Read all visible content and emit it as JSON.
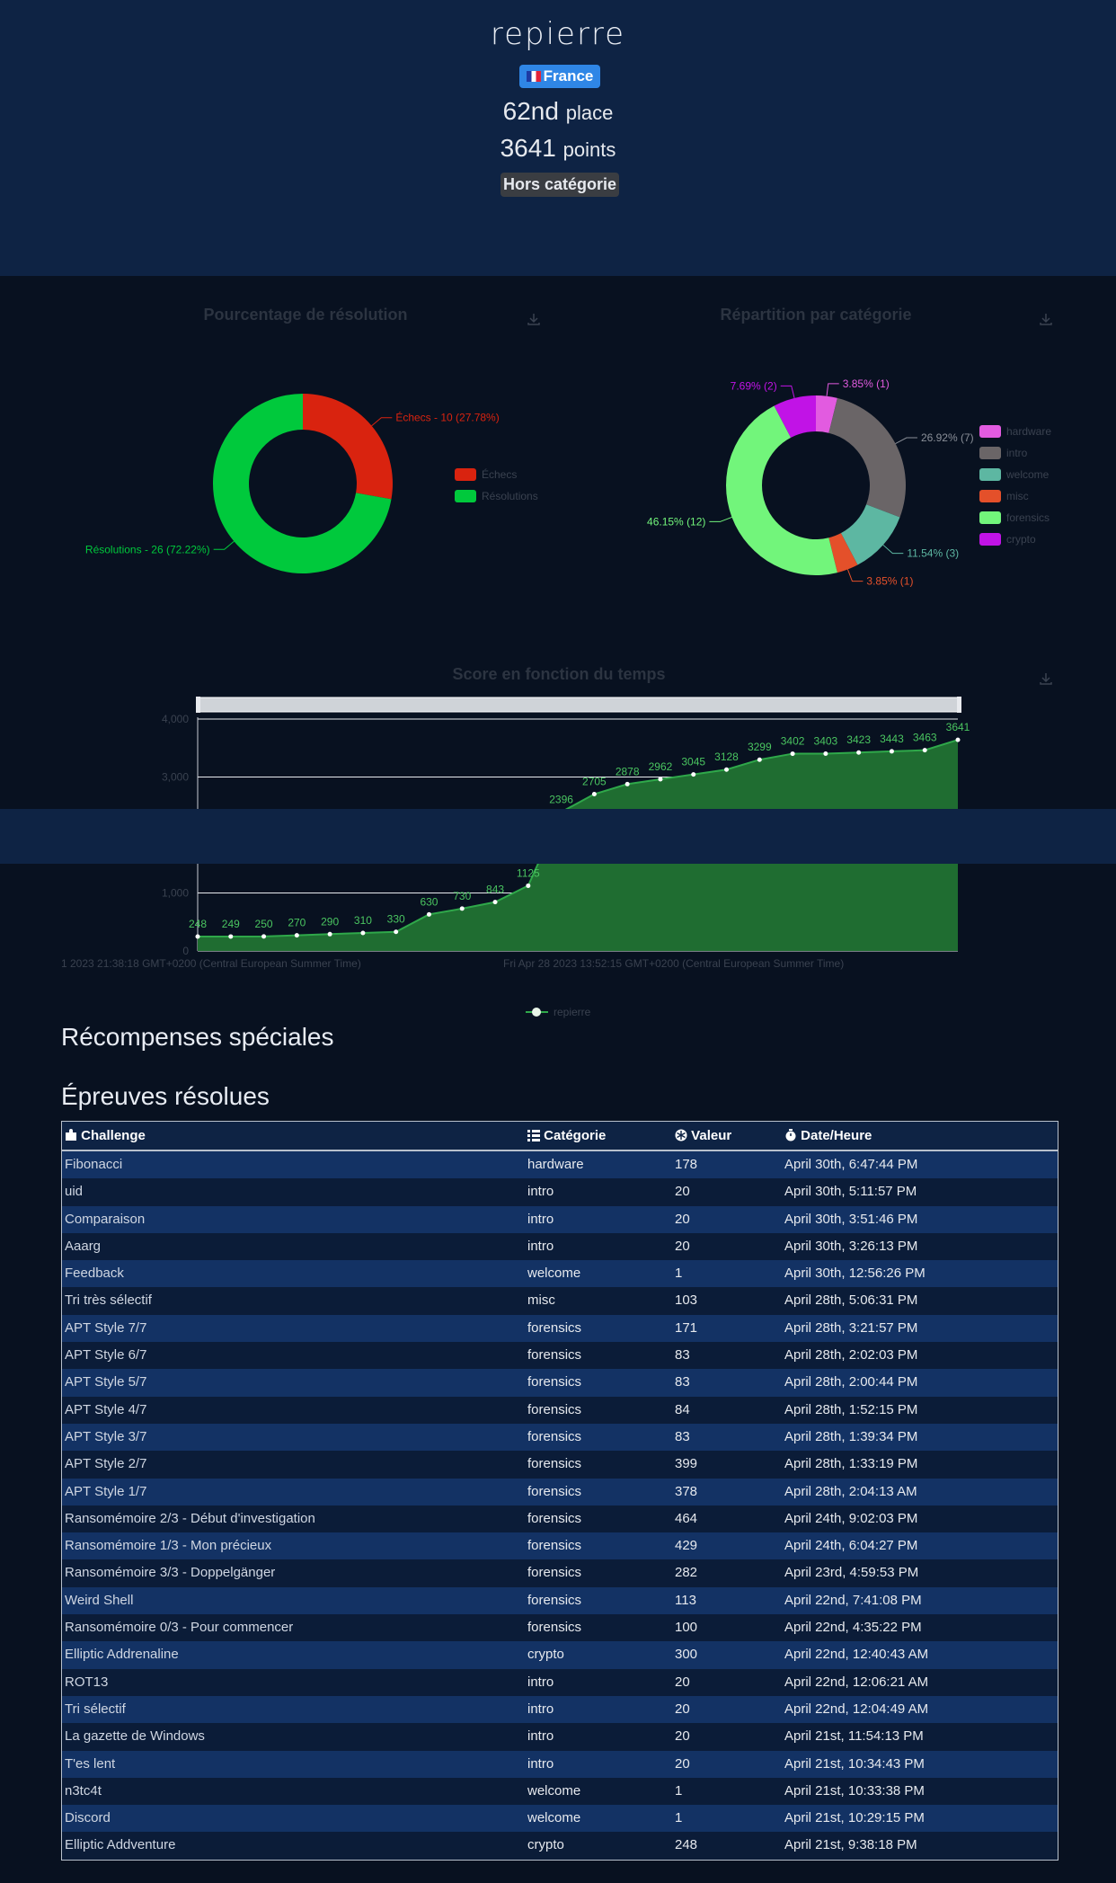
{
  "profile": {
    "username": "repierre",
    "country": "France",
    "rank": "62nd",
    "rank_suffix": "place",
    "points": "3641",
    "points_suffix": "points",
    "category": "Hors catégorie"
  },
  "colors": {
    "header_bg": "#0e2344",
    "page_bg": "#081120",
    "echecs": "#d9230f",
    "resolutions": "#00c93c",
    "hardware": "#e25be0",
    "intro": "#6a6567",
    "welcome": "#5db7a2",
    "misc": "#e4502a",
    "forensics": "#72f57b",
    "crypto": "#c113e6",
    "score_fill": "#1f6d31",
    "score_line": "#2fa84a"
  },
  "chart_resolution": {
    "title": "Pourcentage de résolution",
    "legend": [
      "Échecs",
      "Résolutions"
    ],
    "label_echecs": "Échecs - 10 (27.78%)",
    "label_resolutions": "Résolutions - 26 (72.22%)"
  },
  "chart_categories": {
    "title": "Répartition par catégorie",
    "legend": [
      "hardware",
      "intro",
      "welcome",
      "misc",
      "forensics",
      "crypto"
    ],
    "labels": {
      "hardware": "3.85% (1)",
      "intro": "26.92% (7)",
      "welcome": "11.54% (3)",
      "misc": "3.85% (1)",
      "forensics": "46.15% (12)",
      "crypto": "7.69% (2)"
    }
  },
  "chart_score": {
    "title": "Score en fonction du temps",
    "y_ticks": [
      "4,000",
      "3,000",
      "1,000",
      "0"
    ],
    "x_labels": [
      "1 2023 21:38:18 GMT+0200 (Central European Summer Time)",
      "Fri Apr 28 2023 13:52:15 GMT+0200 (Central European Summer Time)"
    ],
    "legend": "repierre",
    "values_low": [
      "248",
      "249",
      "250",
      "270",
      "290",
      "310",
      "330",
      "630",
      "730",
      "843",
      "1125"
    ],
    "values_high": [
      "2396",
      "2705",
      "2878",
      "2962",
      "3045",
      "3128",
      "3299",
      "3402",
      "3403",
      "3423",
      "3443",
      "3463",
      "3641"
    ]
  },
  "chart_data": [
    {
      "type": "pie",
      "title": "Pourcentage de résolution",
      "categories": [
        "Échecs",
        "Résolutions"
      ],
      "values": [
        10,
        26
      ]
    },
    {
      "type": "pie",
      "title": "Répartition par catégorie",
      "categories": [
        "hardware",
        "intro",
        "welcome",
        "misc",
        "forensics",
        "crypto"
      ],
      "values": [
        1,
        7,
        3,
        1,
        12,
        2
      ]
    },
    {
      "type": "area",
      "title": "Score en fonction du temps",
      "series": [
        {
          "name": "repierre",
          "values": [
            248,
            249,
            250,
            270,
            290,
            310,
            330,
            630,
            730,
            843,
            1125,
            2396,
            2705,
            2878,
            2962,
            3045,
            3128,
            3299,
            3402,
            3403,
            3423,
            3443,
            3463,
            3641
          ]
        }
      ],
      "ylim": [
        0,
        4000
      ]
    }
  ],
  "sections": {
    "special": "Récompenses spéciales",
    "solved": "Épreuves résolues"
  },
  "table": {
    "headers": [
      "Challenge",
      "Catégorie",
      "Valeur",
      "Date/Heure"
    ],
    "rows": [
      [
        "Fibonacci",
        "hardware",
        "178",
        "April 30th, 6:47:44 PM"
      ],
      [
        "uid",
        "intro",
        "20",
        "April 30th, 5:11:57 PM"
      ],
      [
        "Comparaison",
        "intro",
        "20",
        "April 30th, 3:51:46 PM"
      ],
      [
        "Aaarg",
        "intro",
        "20",
        "April 30th, 3:26:13 PM"
      ],
      [
        "Feedback",
        "welcome",
        "1",
        "April 30th, 12:56:26 PM"
      ],
      [
        "Tri très sélectif",
        "misc",
        "103",
        "April 28th, 5:06:31 PM"
      ],
      [
        "APT Style 7/7",
        "forensics",
        "171",
        "April 28th, 3:21:57 PM"
      ],
      [
        "APT Style 6/7",
        "forensics",
        "83",
        "April 28th, 2:02:03 PM"
      ],
      [
        "APT Style 5/7",
        "forensics",
        "83",
        "April 28th, 2:00:44 PM"
      ],
      [
        "APT Style 4/7",
        "forensics",
        "84",
        "April 28th, 1:52:15 PM"
      ],
      [
        "APT Style 3/7",
        "forensics",
        "83",
        "April 28th, 1:39:34 PM"
      ],
      [
        "APT Style 2/7",
        "forensics",
        "399",
        "April 28th, 1:33:19 PM"
      ],
      [
        "APT Style 1/7",
        "forensics",
        "378",
        "April 28th, 2:04:13 AM"
      ],
      [
        "Ransomémoire 2/3 - Début d'investigation",
        "forensics",
        "464",
        "April 24th, 9:02:03 PM"
      ],
      [
        "Ransomémoire 1/3 - Mon précieux",
        "forensics",
        "429",
        "April 24th, 6:04:27 PM"
      ],
      [
        "Ransomémoire 3/3 - Doppelgänger",
        "forensics",
        "282",
        "April 23rd, 4:59:53 PM"
      ],
      [
        "Weird Shell",
        "forensics",
        "113",
        "April 22nd, 7:41:08 PM"
      ],
      [
        "Ransomémoire 0/3 - Pour commencer",
        "forensics",
        "100",
        "April 22nd, 4:35:22 PM"
      ],
      [
        "Elliptic Addrenaline",
        "crypto",
        "300",
        "April 22nd, 12:40:43 AM"
      ],
      [
        "ROT13",
        "intro",
        "20",
        "April 22nd, 12:06:21 AM"
      ],
      [
        "Tri sélectif",
        "intro",
        "20",
        "April 22nd, 12:04:49 AM"
      ],
      [
        "La gazette de Windows",
        "intro",
        "20",
        "April 21st, 11:54:13 PM"
      ],
      [
        "T'es lent",
        "intro",
        "20",
        "April 21st, 10:34:43 PM"
      ],
      [
        "n3tc4t",
        "welcome",
        "1",
        "April 21st, 10:33:38 PM"
      ],
      [
        "Discord",
        "welcome",
        "1",
        "April 21st, 10:29:15 PM"
      ],
      [
        "Elliptic Addventure",
        "crypto",
        "248",
        "April 21st, 9:38:18 PM"
      ]
    ]
  }
}
